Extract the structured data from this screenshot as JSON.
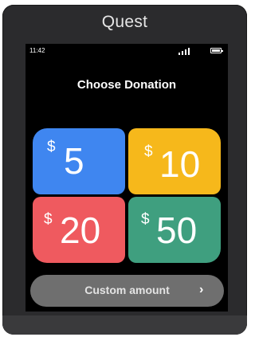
{
  "device": {
    "brand": "Quest"
  },
  "status_bar": {
    "time": "11:42",
    "signal_icon": "signal-icon",
    "battery_icon": "battery-icon"
  },
  "screen": {
    "title": "Choose Donation",
    "options": [
      {
        "currency": "$",
        "amount": "5",
        "color": "#3f86f0"
      },
      {
        "currency": "$",
        "amount": "10",
        "color": "#f6b81b"
      },
      {
        "currency": "$",
        "amount": "20",
        "color": "#ef5a5f"
      },
      {
        "currency": "$",
        "amount": "50",
        "color": "#3f9f7f"
      }
    ],
    "custom_button": {
      "label": "Custom amount",
      "icon": "chevron-right-icon"
    }
  }
}
